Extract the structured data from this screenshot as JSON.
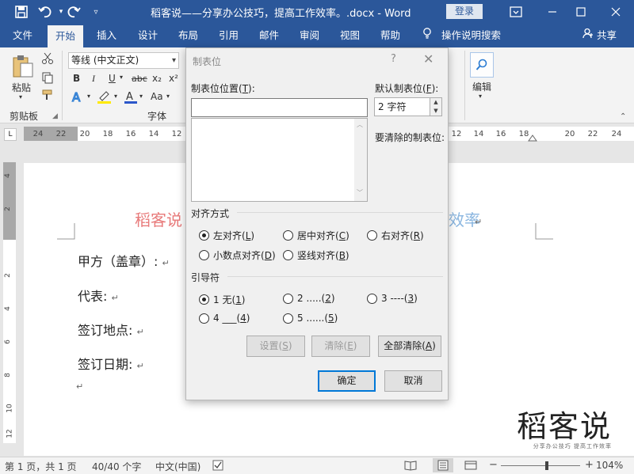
{
  "titlebar": {
    "title": "稻客说——分享办公技巧，提高工作效率。.docx - Word",
    "login": "登录",
    "icons": [
      "save-icon",
      "undo-icon",
      "redo-icon",
      "customize-icon",
      "ribbon-display-icon",
      "minimize-icon",
      "maximize-icon",
      "close-icon"
    ]
  },
  "tabs": [
    "文件",
    "开始",
    "插入",
    "设计",
    "布局",
    "引用",
    "邮件",
    "审阅",
    "视图",
    "帮助"
  ],
  "tell_me": "操作说明搜索",
  "share": "共享",
  "ribbon": {
    "paste": "粘贴",
    "clipboard": "剪贴板",
    "font_name": "等线 (中文正文)",
    "font_group": "字体",
    "editing": "编辑",
    "bold": "B",
    "italic": "I",
    "underline": "U",
    "strike": "abc",
    "sub": "x₂",
    "sup": "x²",
    "aa": "Aa"
  },
  "ruler": {
    "numbers": [
      "24",
      "22",
      "20",
      "18",
      "16",
      "14",
      "12",
      "12",
      "14",
      "16",
      "18",
      "20",
      "22",
      "24"
    ],
    "tab_corner": "L"
  },
  "vruler": [
    "4",
    "2",
    "2",
    "4",
    "6",
    "8",
    "10",
    "12"
  ],
  "document": {
    "title_left": "稻客说",
    "title_right": "效率",
    "lines": [
      "甲方（盖章）:",
      "代表:",
      "签订地点:",
      "签订日期:"
    ],
    "para_mark": "↵"
  },
  "watermark": {
    "big": "稻客说",
    "small": "分享办公技巧  提高工作效率"
  },
  "statusbar": {
    "page": "第 1 页，共 1 页",
    "words": "40/40 个字",
    "language": "中文(中国)",
    "zoom": "104%",
    "zoom_level": 0.58
  },
  "dialog": {
    "title": "制表位",
    "help": "?",
    "close": "✕",
    "tab_position_label": "制表位位置(T):",
    "tab_position_value": "",
    "default_label": "默认制表位(F):",
    "default_value": "2 字符",
    "clear_label": "要清除的制表位:",
    "alignment_label": "对齐方式",
    "alignment": [
      {
        "label": "左对齐(L)",
        "checked": true
      },
      {
        "label": "居中对齐(C)",
        "checked": false
      },
      {
        "label": "右对齐(R)",
        "checked": false
      },
      {
        "label": "小数点对齐(D)",
        "checked": false
      },
      {
        "label": "竖线对齐(B)",
        "checked": false
      }
    ],
    "leader_label": "引导符",
    "leader": [
      {
        "label": "1 无(1)",
        "checked": true
      },
      {
        "label": "2 .....(2)",
        "checked": false
      },
      {
        "label": "3 ----(3)",
        "checked": false
      },
      {
        "label": "4 ___(4)",
        "checked": false
      },
      {
        "label": "5 ......(5)",
        "checked": false
      }
    ],
    "buttons": {
      "set": "设置(S)",
      "clear": "清除(E)",
      "clear_all": "全部清除(A)",
      "ok": "确定",
      "cancel": "取消"
    }
  }
}
